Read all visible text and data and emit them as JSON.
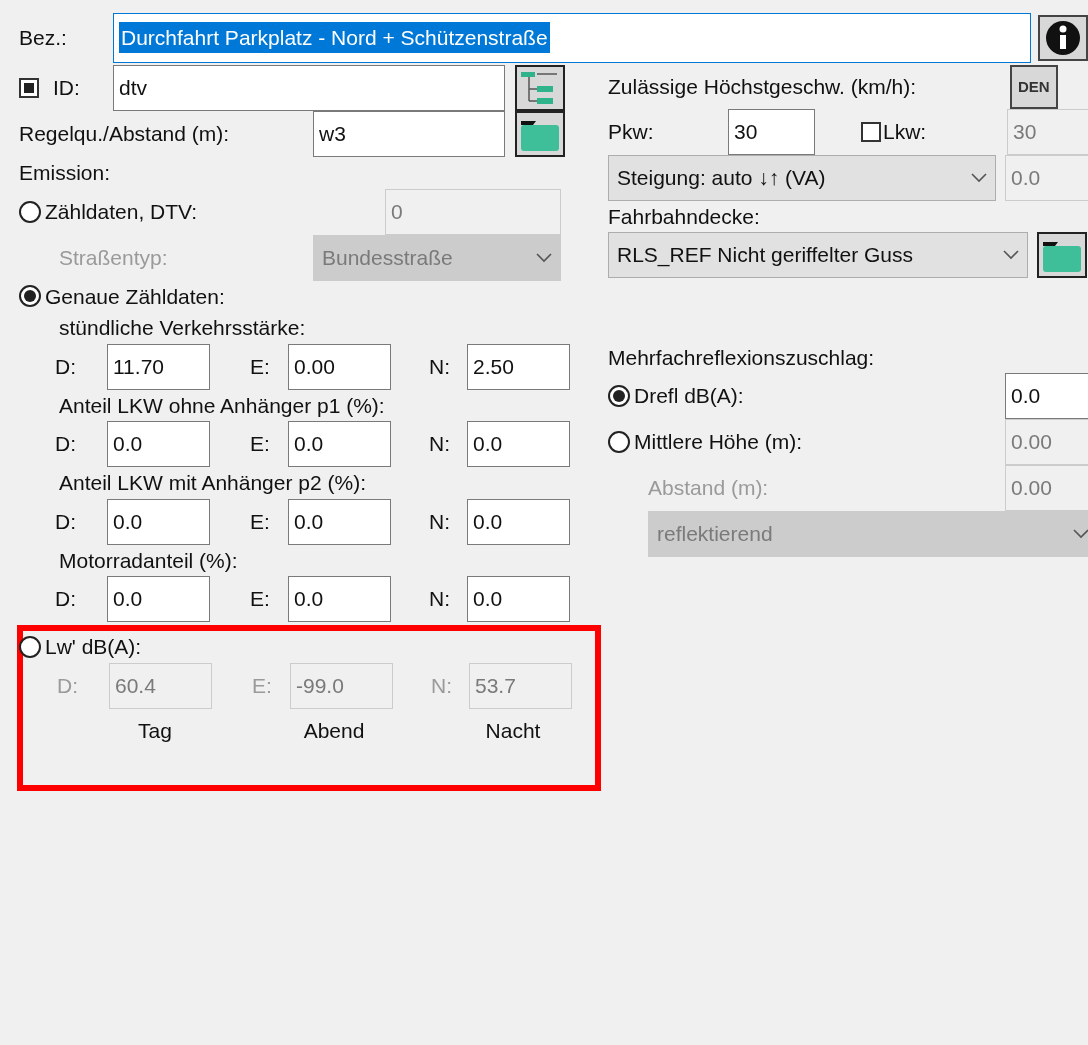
{
  "designation": {
    "label": "Bez.:",
    "value": "Durchfahrt Parkplatz - Nord + Schützenstraße",
    "selected": true
  },
  "id_field": {
    "label": "ID:",
    "checked": true,
    "value": "dtv"
  },
  "cross_section": {
    "label": "Regelqu./Abstand (m):",
    "value": "w3"
  },
  "emission": {
    "label": "Emission:"
  },
  "count_data": {
    "label": "Zähldaten, DTV:",
    "selected": false,
    "value": "0",
    "disabled": true,
    "road_type": {
      "label": "Straßentyp:",
      "value": "Bundesstraße",
      "disabled": true
    }
  },
  "exact_counts": {
    "label": "Genaue Zähldaten:",
    "selected": true,
    "groups": [
      {
        "label": "stündliche Verkehrsstärke:",
        "fields": [
          {
            "label": "D:",
            "value": "11.70"
          },
          {
            "label": "E:",
            "value": "0.00"
          },
          {
            "label": "N:",
            "value": "2.50"
          }
        ]
      },
      {
        "label": "Anteil LKW ohne Anhänger p1 (%):",
        "fields": [
          {
            "label": "D:",
            "value": "0.0"
          },
          {
            "label": "E:",
            "value": "0.0"
          },
          {
            "label": "N:",
            "value": "0.0"
          }
        ]
      },
      {
        "label": "Anteil LKW mit Anhänger p2 (%):",
        "fields": [
          {
            "label": "D:",
            "value": "0.0"
          },
          {
            "label": "E:",
            "value": "0.0"
          },
          {
            "label": "N:",
            "value": "0.0"
          }
        ]
      },
      {
        "label": "Motorradanteil (%):",
        "fields": [
          {
            "label": "D:",
            "value": "0.0"
          },
          {
            "label": "E:",
            "value": "0.0"
          },
          {
            "label": "N:",
            "value": "0.0"
          }
        ]
      }
    ]
  },
  "sound_power": {
    "label": "Lw' dB(A):",
    "selected": false,
    "disabled": true,
    "fields": [
      {
        "label": "D:",
        "value": "60.4"
      },
      {
        "label": "E:",
        "value": "-99.0"
      },
      {
        "label": "N:",
        "value": "53.7"
      }
    ],
    "column_labels": [
      "Tag",
      "Abend",
      "Nacht"
    ]
  },
  "speed": {
    "label": "Zulässige Höchstgeschw. (km/h):",
    "button": "DEN",
    "car": {
      "label": "Pkw:",
      "value": "30"
    },
    "truck": {
      "label": "Lkw:",
      "checked": false,
      "value": "30",
      "disabled": true
    }
  },
  "gradient": {
    "value": "Steigung: auto ↓↑ (VA)",
    "input": "0.0",
    "input_disabled": true
  },
  "surface": {
    "label": "Fahrbahndecke:",
    "value": "RLS_REF Nicht geriffelter Guss"
  },
  "reflection": {
    "label": "Mehrfachreflexionszuschlag:",
    "options": [
      {
        "label": "Drefl dB(A):",
        "selected": true,
        "value": "0.0",
        "disabled": false
      },
      {
        "label": "Mittlere Höhe (m):",
        "selected": false,
        "value": "0.00",
        "disabled": true
      }
    ],
    "distance": {
      "label": "Abstand (m):",
      "value": "0.00",
      "disabled": true
    },
    "type": {
      "value": "reflektierend",
      "disabled": true
    }
  }
}
